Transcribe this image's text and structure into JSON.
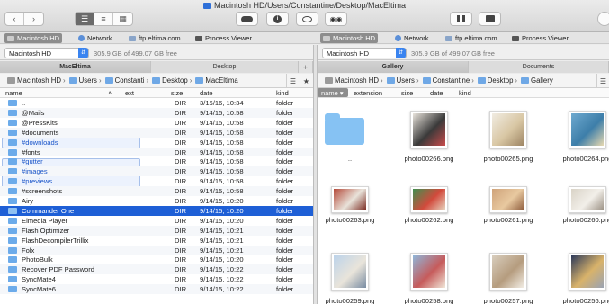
{
  "window": {
    "title": "Macintosh HD/Users/Constantine/Desktop/MacEltima"
  },
  "toolbar": {
    "icons": [
      "back-icon",
      "forward-icon",
      "list-view-icon",
      "columns-view-icon",
      "grid-view-icon",
      "toggle-icon",
      "info-icon",
      "eye-icon",
      "binoculars-icon",
      "panels-icon",
      "terminal-icon"
    ]
  },
  "favorites": [
    {
      "label": "Macintosh HD",
      "icon": "drive-icon"
    },
    {
      "label": "Network",
      "icon": "globe-icon"
    },
    {
      "label": "ftp.eltima.com",
      "icon": "ftp-icon"
    },
    {
      "label": "Process Viewer",
      "icon": "process-icon"
    }
  ],
  "left": {
    "drive": {
      "name": "Macintosh HD",
      "free": "305.9 GB of 499.07 GB free"
    },
    "tabs": [
      "MacEltima",
      "Desktop"
    ],
    "breadcrumb": [
      "Macintosh HD",
      "Users",
      "Constanti",
      "Desktop",
      "MacEltima"
    ],
    "columns": {
      "name": "name",
      "ext": "ext",
      "size": "size",
      "date": "date",
      "kind": "kind"
    },
    "rows": [
      {
        "name": "..",
        "size": "DIR",
        "date": "3/16/16, 10:34",
        "kind": "folder"
      },
      {
        "name": "@Mails",
        "size": "DIR",
        "date": "9/14/15, 10:58",
        "kind": "folder"
      },
      {
        "name": "@PressKits",
        "size": "DIR",
        "date": "9/14/15, 10:58",
        "kind": "folder"
      },
      {
        "name": "#documents",
        "size": "DIR",
        "date": "9/14/15, 10:58",
        "kind": "folder"
      },
      {
        "name": "#downloads",
        "size": "DIR",
        "date": "9/14/15, 10:58",
        "kind": "folder"
      },
      {
        "name": "#fonts",
        "size": "DIR",
        "date": "9/14/15, 10:58",
        "kind": "folder"
      },
      {
        "name": "#gutter",
        "size": "DIR",
        "date": "9/14/15, 10:58",
        "kind": "folder"
      },
      {
        "name": "#images",
        "size": "DIR",
        "date": "9/14/15, 10:58",
        "kind": "folder"
      },
      {
        "name": "#previews",
        "size": "DIR",
        "date": "9/14/15, 10:58",
        "kind": "folder"
      },
      {
        "name": "#screenshots",
        "size": "DIR",
        "date": "9/14/15, 10:58",
        "kind": "folder"
      },
      {
        "name": "Airy",
        "size": "DIR",
        "date": "9/14/15, 10:20",
        "kind": "folder"
      },
      {
        "name": "Commander One",
        "size": "DIR",
        "date": "9/14/15, 10:20",
        "kind": "folder"
      },
      {
        "name": "Elmedia Player",
        "size": "DIR",
        "date": "9/14/15, 10:20",
        "kind": "folder"
      },
      {
        "name": "Flash Optimizer",
        "size": "DIR",
        "date": "9/14/15, 10:21",
        "kind": "folder"
      },
      {
        "name": "FlashDecompilerTrillix",
        "size": "DIR",
        "date": "9/14/15, 10:21",
        "kind": "folder"
      },
      {
        "name": "Folx",
        "size": "DIR",
        "date": "9/14/15, 10:21",
        "kind": "folder"
      },
      {
        "name": "PhotoBulk",
        "size": "DIR",
        "date": "9/14/15, 10:20",
        "kind": "folder"
      },
      {
        "name": "Recover PDF Password",
        "size": "DIR",
        "date": "9/14/15, 10:22",
        "kind": "folder"
      },
      {
        "name": "SyncMate4",
        "size": "DIR",
        "date": "9/14/15, 10:22",
        "kind": "folder"
      },
      {
        "name": "SyncMate6",
        "size": "DIR",
        "date": "9/14/15, 10:22",
        "kind": "folder"
      }
    ]
  },
  "right": {
    "drive": {
      "name": "Macintosh HD",
      "free": "305.9 GB of 499.07 GB free"
    },
    "tabs": [
      "Gallery",
      "Documents"
    ],
    "breadcrumb": [
      "Macintosh HD",
      "Users",
      "Constantine",
      "Desktop",
      "Gallery"
    ],
    "columns": {
      "name": "name",
      "extension": "extension",
      "size": "size",
      "date": "date",
      "kind": "kind"
    },
    "items": [
      {
        "label": "..",
        "type": "folder"
      },
      {
        "label": "photo00266.png",
        "type": "image",
        "colors": [
          "#e9e4dc",
          "#3a3a3a",
          "#c94b4b"
        ]
      },
      {
        "label": "photo00265.png",
        "type": "image",
        "colors": [
          "#f1ece2",
          "#d8c6a3",
          "#9c8462"
        ]
      },
      {
        "label": "photo00264.png",
        "type": "image",
        "colors": [
          "#6ea9cf",
          "#3d7ea9",
          "#e8d9b0"
        ]
      },
      {
        "label": "photo00263.png",
        "type": "image",
        "colors": [
          "#b44a3a",
          "#e9e3da",
          "#7a2a20"
        ]
      },
      {
        "label": "photo00262.png",
        "type": "image",
        "colors": [
          "#3f8f4f",
          "#d24a3c",
          "#e7d7c2"
        ]
      },
      {
        "label": "photo00261.png",
        "type": "image",
        "colors": [
          "#cfa37a",
          "#e8c9a0",
          "#8c5a3a"
        ]
      },
      {
        "label": "photo00260.png",
        "type": "image",
        "colors": [
          "#d9d3c7",
          "#f2efe9",
          "#9a9083"
        ]
      },
      {
        "label": "photo00259.png",
        "type": "image",
        "colors": [
          "#bcd3ea",
          "#e9e4da",
          "#7a8da3"
        ]
      },
      {
        "label": "photo00258.png",
        "type": "image",
        "colors": [
          "#8fb6d9",
          "#c65b5b",
          "#f0e6d8"
        ]
      },
      {
        "label": "photo00257.png",
        "type": "image",
        "colors": [
          "#d8cdbd",
          "#b59c7e",
          "#f4efe7"
        ]
      },
      {
        "label": "photo00256.png",
        "type": "image",
        "colors": [
          "#2d3a5a",
          "#d9b36a",
          "#9aa3b3"
        ]
      }
    ]
  }
}
